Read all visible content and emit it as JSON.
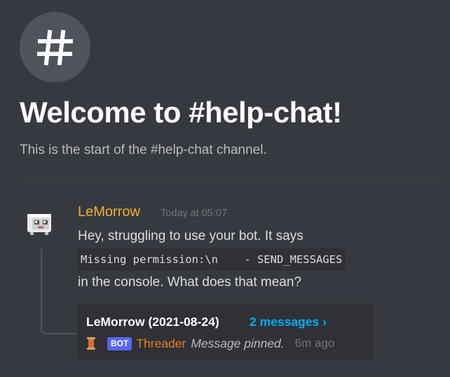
{
  "welcome": {
    "icon": "hashtag-icon",
    "title": "Welcome to #help-chat!",
    "subtitle": "This is the start of the #help-chat channel."
  },
  "message": {
    "author": "LeMorrow",
    "author_color": "#f0b132",
    "timestamp": "Today at 05:07",
    "line1": "Hey, struggling to use your bot. It says",
    "code": "Missing permission:\\n    - SEND_MESSAGES",
    "line2": "in the console. What does that mean?"
  },
  "thread": {
    "name": "LeMorrow (2021-08-24)",
    "count": "2 messages ›",
    "icon": "spool-icon",
    "badge": "BOT",
    "bot_name": "Threader",
    "pinned_text": "Message pinned.",
    "ago": "6m ago"
  }
}
